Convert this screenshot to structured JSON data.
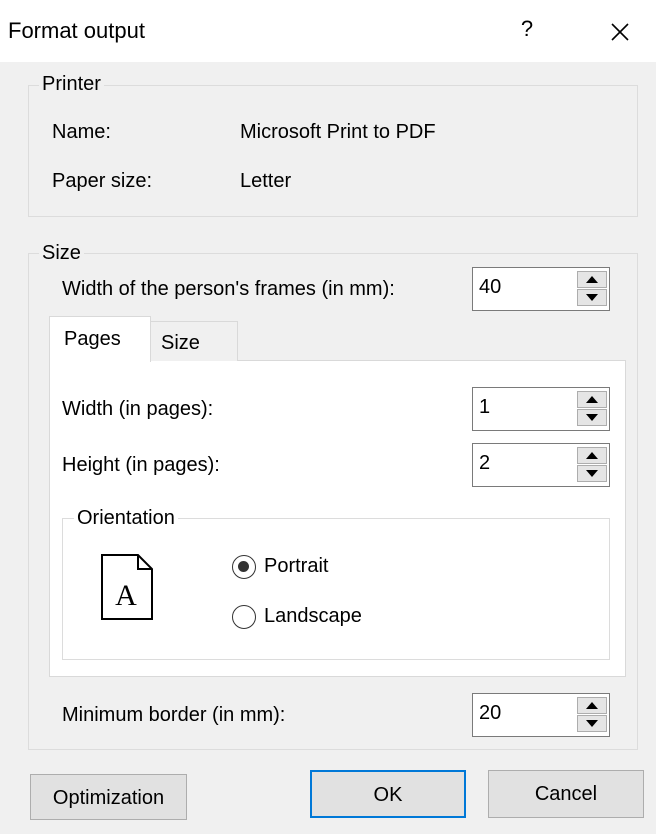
{
  "window": {
    "title": "Format output",
    "help": "?"
  },
  "printer": {
    "legend": "Printer",
    "name_label": "Name:",
    "name_value": "Microsoft Print to PDF",
    "paper_label": "Paper size:",
    "paper_value": "Letter"
  },
  "size": {
    "legend": "Size",
    "frame_width_label": "Width of the person's frames (in mm):",
    "frame_width_value": "40",
    "tabs": [
      {
        "label": "Pages",
        "selected": true
      },
      {
        "label": "Size",
        "selected": false
      }
    ],
    "pages": {
      "width_label": "Width (in pages):",
      "width_value": "1",
      "height_label": "Height (in pages):",
      "height_value": "2",
      "orientation": {
        "legend": "Orientation",
        "page_icon_letter": "A",
        "portrait_label": "Portrait",
        "landscape_label": "Landscape",
        "selected": "Portrait"
      }
    },
    "min_border_label": "Minimum border (in mm):",
    "min_border_value": "20"
  },
  "buttons": {
    "optimization": "Optimization",
    "ok": "OK",
    "cancel": "Cancel"
  }
}
